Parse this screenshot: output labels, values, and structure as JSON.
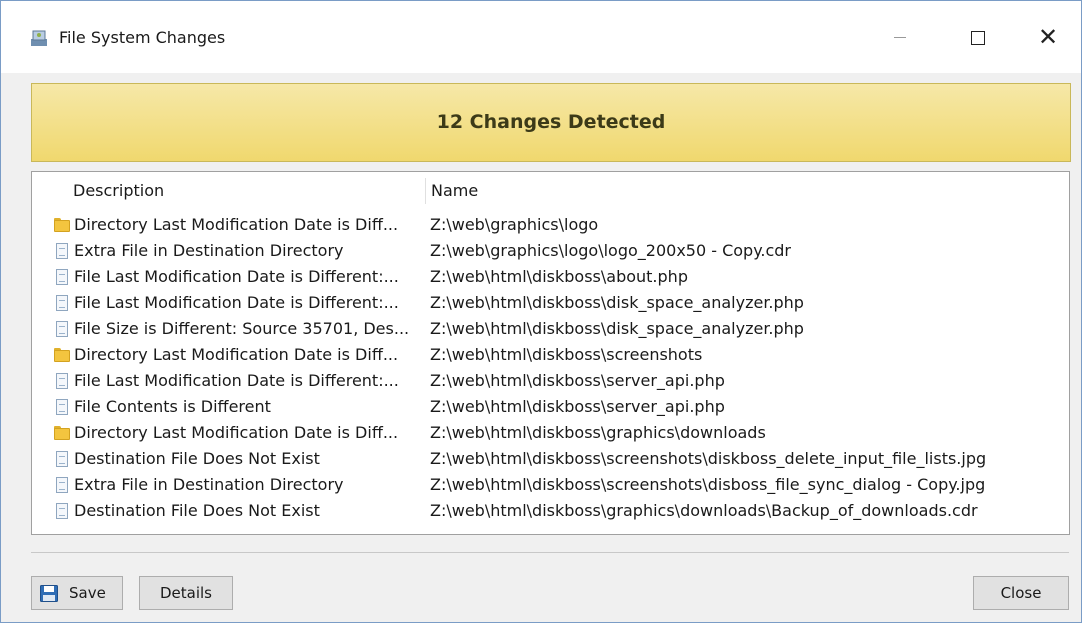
{
  "window": {
    "title": "File System Changes",
    "close_glyph": "✕"
  },
  "banner": {
    "text": "12 Changes Detected"
  },
  "list": {
    "columns": {
      "description": "Description",
      "name": "Name"
    },
    "rows": [
      {
        "icon": "folder-icon",
        "description": "Directory Last Modification Date is Diff...",
        "name": "Z:\\web\\graphics\\logo"
      },
      {
        "icon": "file-icon",
        "description": "Extra File in Destination Directory",
        "name": "Z:\\web\\graphics\\logo\\logo_200x50 - Copy.cdr"
      },
      {
        "icon": "file-icon",
        "description": "File Last Modification Date is Different:...",
        "name": "Z:\\web\\html\\diskboss\\about.php"
      },
      {
        "icon": "file-icon",
        "description": "File Last Modification Date is Different:...",
        "name": "Z:\\web\\html\\diskboss\\disk_space_analyzer.php"
      },
      {
        "icon": "file-icon",
        "description": "File Size is Different: Source 35701, Des...",
        "name": "Z:\\web\\html\\diskboss\\disk_space_analyzer.php"
      },
      {
        "icon": "folder-icon",
        "description": "Directory Last Modification Date is Diff...",
        "name": "Z:\\web\\html\\diskboss\\screenshots"
      },
      {
        "icon": "file-icon",
        "description": "File Last Modification Date is Different:...",
        "name": "Z:\\web\\html\\diskboss\\server_api.php"
      },
      {
        "icon": "file-icon",
        "description": "File Contents is Different",
        "name": "Z:\\web\\html\\diskboss\\server_api.php"
      },
      {
        "icon": "folder-icon",
        "description": "Directory Last Modification Date is Diff...",
        "name": "Z:\\web\\html\\diskboss\\graphics\\downloads"
      },
      {
        "icon": "file-icon",
        "description": "Destination File Does Not Exist",
        "name": "Z:\\web\\html\\diskboss\\screenshots\\diskboss_delete_input_file_lists.jpg"
      },
      {
        "icon": "file-icon",
        "description": "Extra File in Destination Directory",
        "name": "Z:\\web\\html\\diskboss\\screenshots\\disboss_file_sync_dialog - Copy.jpg"
      },
      {
        "icon": "file-icon",
        "description": "Destination File Does Not Exist",
        "name": "Z:\\web\\html\\diskboss\\graphics\\downloads\\Backup_of_downloads.cdr"
      }
    ]
  },
  "buttons": {
    "save": "Save",
    "details": "Details",
    "close": "Close"
  },
  "colors": {
    "banner": "#f0d86e",
    "accent": "#2f6db5"
  }
}
